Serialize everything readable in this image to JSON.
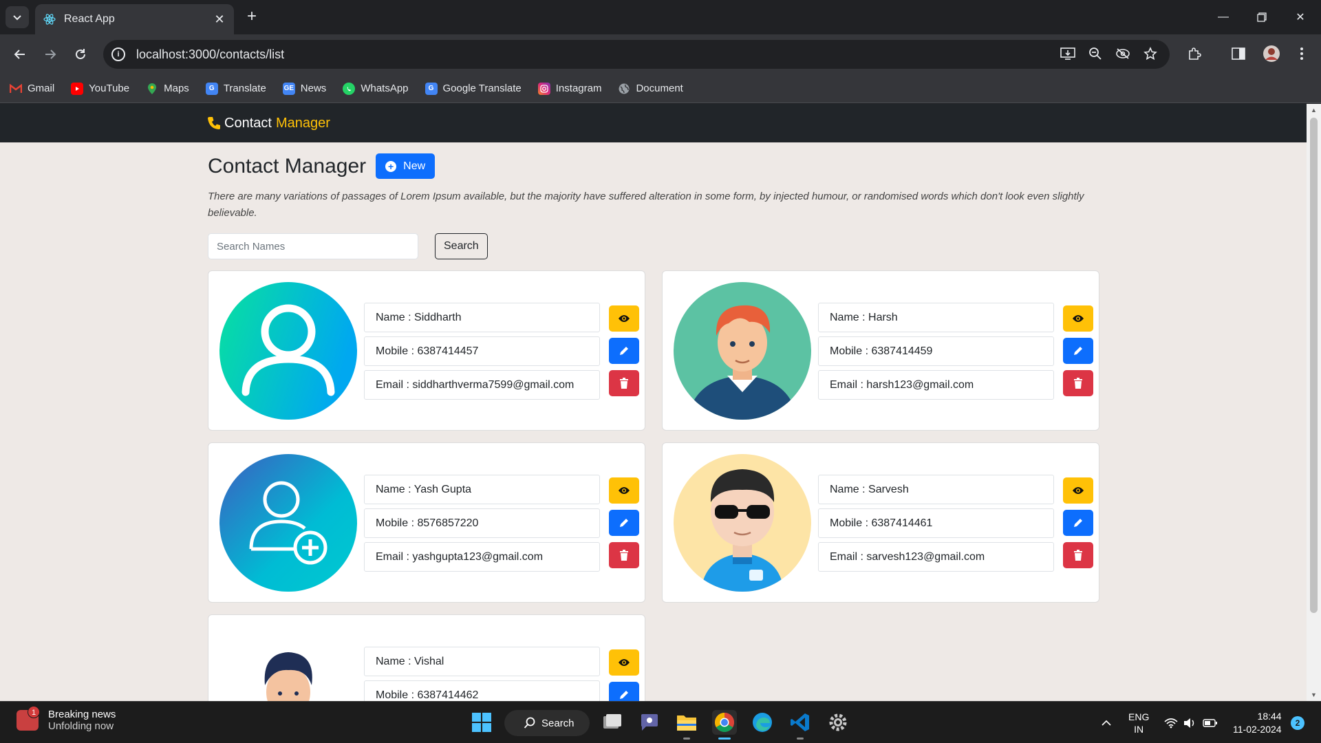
{
  "browser": {
    "tab_title": "React App",
    "url": "localhost:3000/contacts/list",
    "bookmarks": [
      {
        "label": "Gmail",
        "icon": "gmail-icon",
        "color": "#ea4335"
      },
      {
        "label": "YouTube",
        "icon": "youtube-icon",
        "color": "#ff0000"
      },
      {
        "label": "Maps",
        "icon": "maps-icon",
        "color": "#34a853"
      },
      {
        "label": "Translate",
        "icon": "translate-icon",
        "color": "#4285f4"
      },
      {
        "label": "News",
        "icon": "news-icon",
        "color": "#4285f4"
      },
      {
        "label": "WhatsApp",
        "icon": "whatsapp-icon",
        "color": "#25d366"
      },
      {
        "label": "Google Translate",
        "icon": "google-translate-icon",
        "color": "#4285f4"
      },
      {
        "label": "Instagram",
        "icon": "instagram-icon",
        "color": "#e1306c"
      },
      {
        "label": "Document",
        "icon": "globe-icon",
        "color": "#9aa0a6"
      }
    ]
  },
  "navbar": {
    "brand_prefix": "Contact",
    "brand_accent": "Manager"
  },
  "main": {
    "title": "Contact Manager",
    "new_button": "New",
    "description": "There are many variations of passages of Lorem Ipsum available, but the majority have suffered alteration in some form, by injected humour, or randomised words which don't look even slightly believable.",
    "search_placeholder": "Search Names",
    "search_button": "Search"
  },
  "contacts": [
    {
      "name": "Name : Siddharth",
      "mobile": "Mobile : 6387414457",
      "email": "Email : siddharthverma7599@gmail.com",
      "avatar": "person-outline-avatar"
    },
    {
      "name": "Name : Harsh",
      "mobile": "Mobile : 6387414459",
      "email": "Email : harsh123@gmail.com",
      "avatar": "red-hair-man-avatar"
    },
    {
      "name": "Name : Yash Gupta",
      "mobile": "Mobile : 8576857220",
      "email": "Email : yashgupta123@gmail.com",
      "avatar": "add-user-avatar"
    },
    {
      "name": "Name : Sarvesh",
      "mobile": "Mobile : 6387414461",
      "email": "Email : sarvesh123@gmail.com",
      "avatar": "sunglasses-man-avatar"
    },
    {
      "name": "Name : Vishal",
      "mobile": "Mobile : 6387414462",
      "email": "",
      "avatar": "dark-hair-man-avatar"
    }
  ],
  "taskbar": {
    "news_title": "Breaking news",
    "news_subtitle": "Unfolding now",
    "news_badge": "1",
    "search_label": "Search",
    "lang_top": "ENG",
    "lang_bottom": "IN",
    "time": "18:44",
    "date": "11-02-2024",
    "notification_count": "2"
  },
  "colors": {
    "brand_accent": "#ffc107",
    "primary": "#0d6efd",
    "danger": "#dc3545",
    "warning": "#ffc107"
  }
}
